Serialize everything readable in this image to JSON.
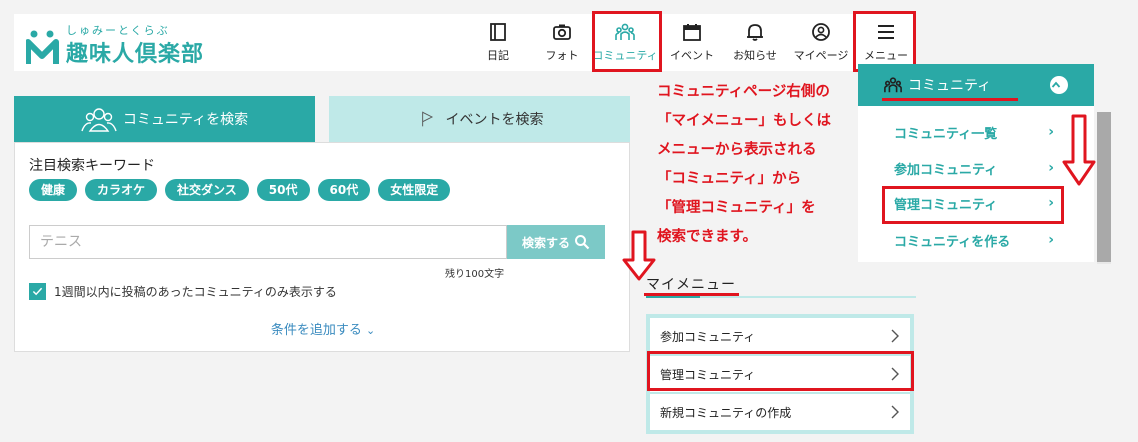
{
  "logo": {
    "subtitle": "しゅみーとくらぶ",
    "title": "趣味人倶楽部"
  },
  "nav": [
    {
      "label": "日記",
      "icon": "diary-icon"
    },
    {
      "label": "フォト",
      "icon": "camera-icon"
    },
    {
      "label": "コミュニティ",
      "icon": "community-icon"
    },
    {
      "label": "イベント",
      "icon": "calendar-icon"
    },
    {
      "label": "お知らせ",
      "icon": "bell-icon"
    },
    {
      "label": "マイページ",
      "icon": "user-icon"
    },
    {
      "label": "メニュー",
      "icon": "hamburger-icon"
    }
  ],
  "search": {
    "tab_community": "コミュニティを検索",
    "tab_event": "イベントを検索",
    "keyword_title": "注目検索キーワード",
    "keywords": [
      "健康",
      "カラオケ",
      "社交ダンス",
      "50代",
      "60代",
      "女性限定"
    ],
    "placeholder": "テニス",
    "button_label": "検索する",
    "char_limit": "残り100文字",
    "checkbox_label": "1週間以内に投稿のあったコミュニティのみ表示する",
    "add_condition": "条件を追加する"
  },
  "annotation": {
    "lines": [
      "コミュニティページ右側の",
      "「マイメニュー」もしくは",
      "メニューから表示される",
      "「コミュニティ」から",
      "「管理コミュニティ」を",
      "検索できます。"
    ]
  },
  "mymenu": {
    "title": "マイメニュー",
    "items": [
      "参加コミュニティ",
      "管理コミュニティ",
      "新規コミュニティの作成"
    ]
  },
  "dropdown": {
    "header": "コミュニティ",
    "items": [
      "コミュニティ一覧",
      "参加コミュニティ",
      "管理コミュニティ",
      "コミュニティを作る"
    ]
  },
  "colors": {
    "brand": "#2aa9a6",
    "brand_light": "#bfe9e8",
    "highlight": "#e0151f"
  }
}
